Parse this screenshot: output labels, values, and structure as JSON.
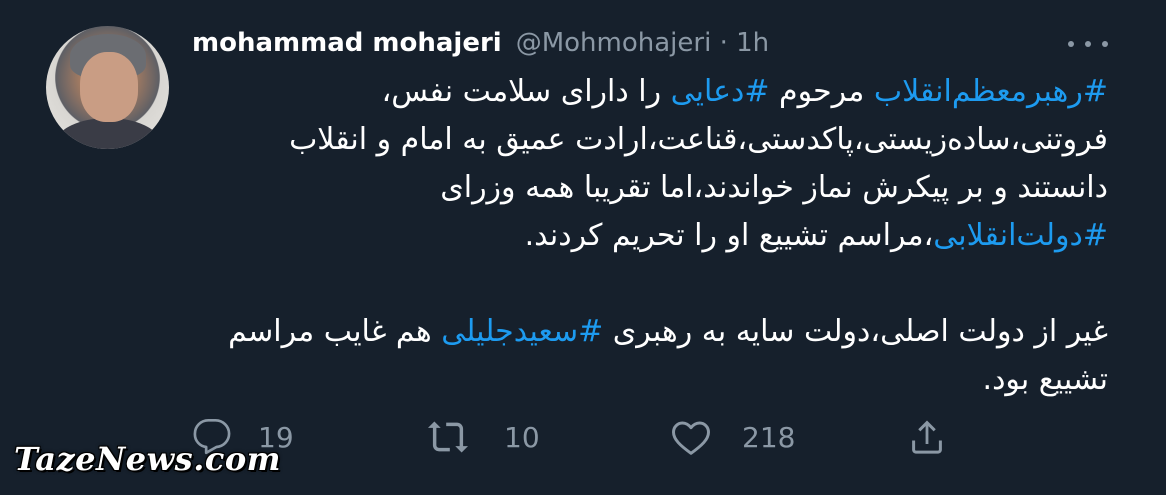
{
  "tweet": {
    "author_name": "mohammad mohajeri",
    "author_handle": "@Mohmohajeri",
    "separator": "·",
    "time": "1h",
    "paragraph1": [
      {
        "text": "#رهبرمعظم‌انقلاب",
        "hashtag": true
      },
      {
        "text": " مرحوم ",
        "hashtag": false
      },
      {
        "text": "#دعایی",
        "hashtag": true
      },
      {
        "text": " را دارای سلامت نفس، فروتنی،ساده‌زیستی،پاکدستی،قناعت،ارادت عمیق به امام و انقلاب دانستند و بر پیکرش نماز خواندند،اما تقریبا همه وزرای ",
        "hashtag": false
      },
      {
        "text": "#دولت‌انقلابی",
        "hashtag": true
      },
      {
        "text": "،مراسم تشییع او را تحریم کردند.",
        "hashtag": false
      }
    ],
    "paragraph2": [
      {
        "text": "غیر از دولت اصلی،دولت سایه به رهبری ",
        "hashtag": false
      },
      {
        "text": "#سعیدجلیلی",
        "hashtag": true
      },
      {
        "text": " هم غایب مراسم تشییع بود.",
        "hashtag": false
      }
    ]
  },
  "actions": {
    "reply_icon": "comment-bubble-icon",
    "reply_count": "19",
    "retweet_icon": "retweet-icon",
    "retweet_count": "10",
    "like_icon": "heart-icon",
    "like_count": "218",
    "share_icon": "share-upload-icon"
  },
  "watermark": "TazeNews.com",
  "colors": {
    "background": "#16202c",
    "hashtag": "#1d9bf0",
    "muted": "#8b98a5",
    "text": "#ffffff"
  }
}
